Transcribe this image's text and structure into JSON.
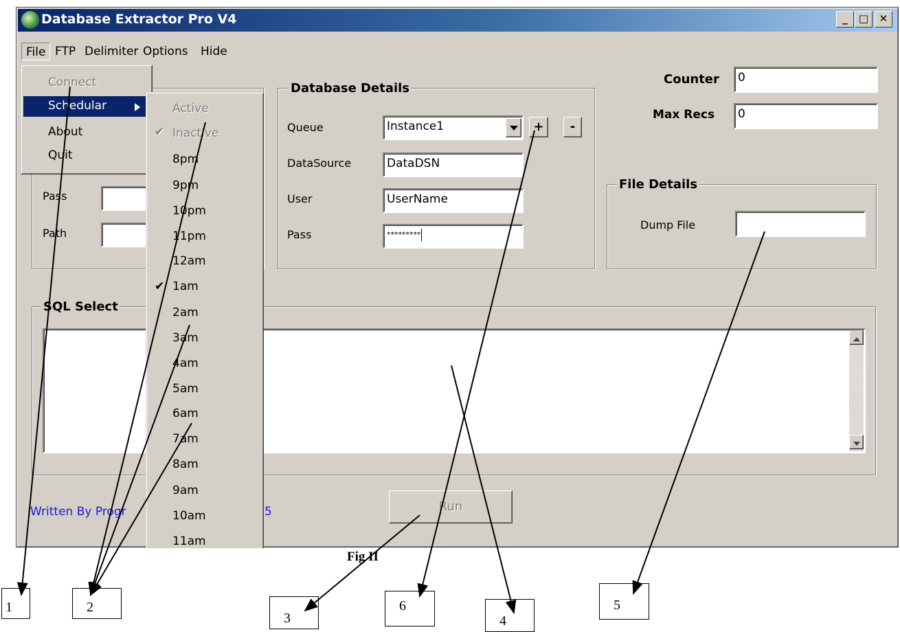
{
  "window": {
    "title": "Database Extractor Pro V4",
    "caption_buttons": {
      "minimize": "_",
      "maximize": "□",
      "close": "✕"
    }
  },
  "menubar": [
    "File",
    "FTP",
    "Delimiter",
    "Options",
    "Hide"
  ],
  "file_menu": [
    "Connect",
    "Schedular",
    "About",
    "Quit"
  ],
  "schedule_menu": [
    "Active",
    "Inactive",
    "8pm",
    "9pm",
    "10pm",
    "11pm",
    "12am",
    "1am",
    "2am",
    "3am",
    "4am",
    "5am",
    "6am",
    "7am",
    "8am",
    "9am",
    "10am",
    "11am"
  ],
  "schedule_checked": [
    "Inactive",
    "1am"
  ],
  "partial_group": {
    "pass_label": "Pass",
    "path_label": "Path"
  },
  "database": {
    "title": "Database Details",
    "queue_label": "Queue",
    "queue_value": "Instance1",
    "datasource_label": "DataSource",
    "datasource_value": "DataDSN",
    "user_label": "User",
    "user_value": "UserName",
    "pass_label": "Pass",
    "pass_value": "*********",
    "plus": "+",
    "minus": "-"
  },
  "counter": {
    "label": "Counter",
    "value": "0"
  },
  "maxrecs": {
    "label": "Max Recs",
    "value": "0"
  },
  "file_details": {
    "title": "File Details",
    "dump_label": "Dump File",
    "dump_value": ""
  },
  "sql": {
    "title": "SQL Select",
    "text": ""
  },
  "footer": {
    "written_by": "Written By Progr",
    "written_by_tail": "5",
    "run_label": "Run"
  },
  "caption": "Fig II",
  "annotations": [
    "1",
    "2",
    "3",
    "6",
    "4",
    "5"
  ],
  "colors": {
    "title_start": "#0a246a",
    "title_end": "#a6caf0",
    "face": "#d4d0c8",
    "highlight": "#0a246a",
    "link": "#0000ff"
  },
  "icons": [
    "app-icon",
    "dropdown-arrow-icon",
    "submenu-arrow-icon",
    "checkmark-icon",
    "scroll-up-icon",
    "scroll-down-icon"
  ]
}
